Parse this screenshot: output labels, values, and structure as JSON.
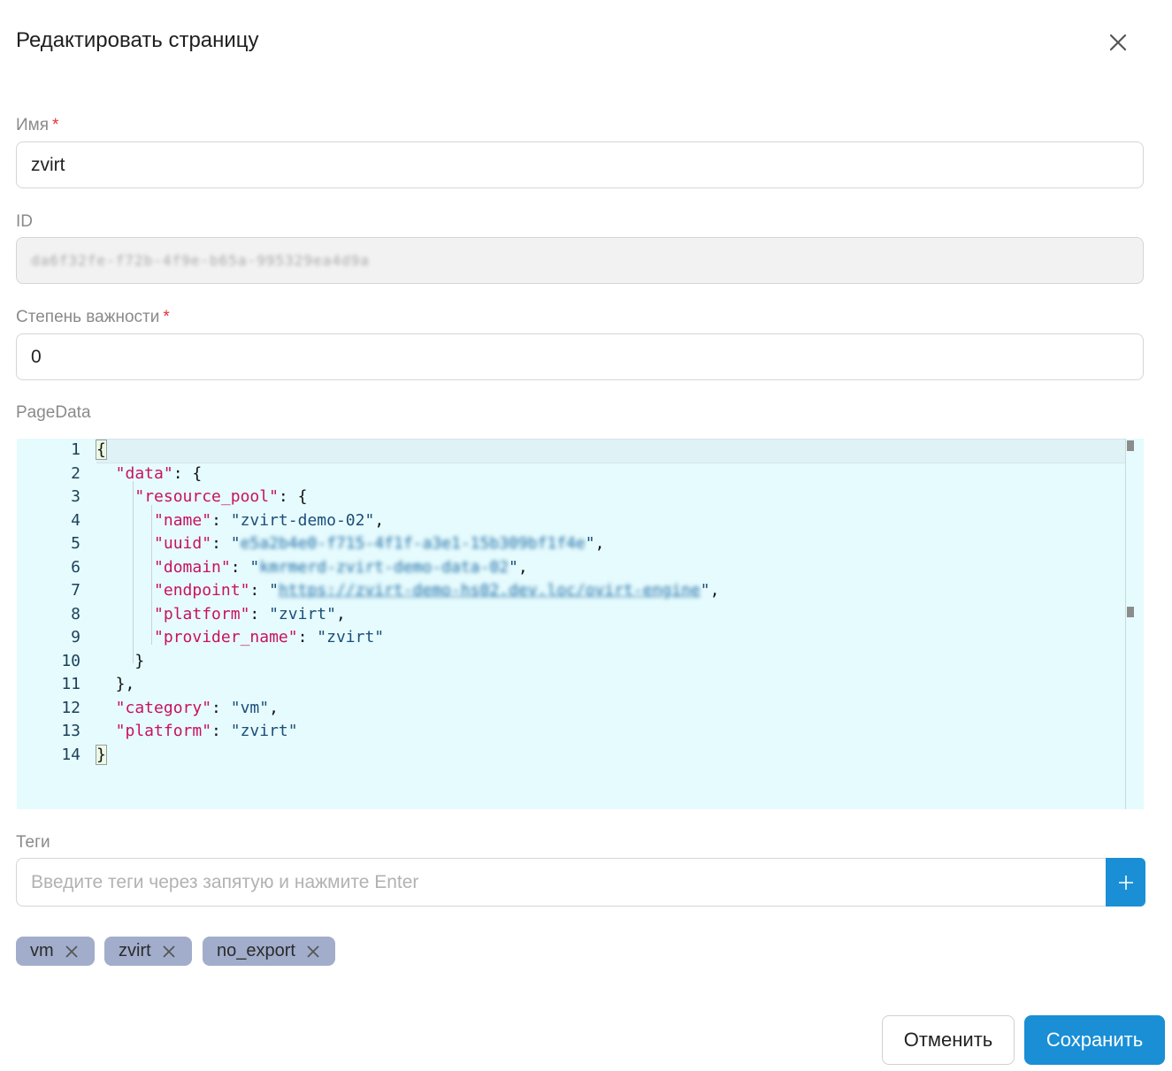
{
  "dialog": {
    "title": "Редактировать страницу",
    "close_icon": "close-icon"
  },
  "form": {
    "name": {
      "label": "Имя",
      "required_mark": "*",
      "value": "zvirt"
    },
    "id": {
      "label": "ID",
      "value": "da6f32fe-f72b-4f9e-b65a-995329ea4d9a"
    },
    "severity": {
      "label": "Степень важности",
      "required_mark": "*",
      "value": "0"
    },
    "page_data": {
      "label": "PageData",
      "lines": [
        {
          "n": "1"
        },
        {
          "n": "2",
          "key": "\"data\"",
          "after": ": {"
        },
        {
          "n": "3",
          "key": "\"resource_pool\"",
          "after": ": {"
        },
        {
          "n": "4",
          "key": "\"name\"",
          "colon": ": ",
          "val": "\"zvirt-demo-02\"",
          "tail": ","
        },
        {
          "n": "5",
          "key": "\"uuid\"",
          "colon": ": ",
          "val_open": "\"",
          "val_blur": "e5a2b4e0-f715-4f1f-a3e1-15b309bf1f4e",
          "val_close": "\"",
          "tail": ","
        },
        {
          "n": "6",
          "key": "\"domain\"",
          "colon": ": ",
          "val_open": "\"",
          "val_blur": "kmrmerd-zvirt-demo-data-02",
          "val_close": "\"",
          "tail": ","
        },
        {
          "n": "7",
          "key": "\"endpoint\"",
          "colon": ": ",
          "val_open": "\"",
          "val_blur": "https://zvirt-demo-hs02.dev.loc/ovirt-engine",
          "val_close": "\"",
          "tail": ","
        },
        {
          "n": "8",
          "key": "\"platform\"",
          "colon": ": ",
          "val": "\"zvirt\"",
          "tail": ","
        },
        {
          "n": "9",
          "key": "\"provider_name\"",
          "colon": ": ",
          "val": "\"zvirt\"",
          "tail": ""
        },
        {
          "n": "10",
          "after": "}"
        },
        {
          "n": "11",
          "after": "},"
        },
        {
          "n": "12",
          "key": "\"category\"",
          "colon": ": ",
          "val": "\"vm\"",
          "tail": ","
        },
        {
          "n": "13",
          "key": "\"platform\"",
          "colon": ": ",
          "val": "\"zvirt\"",
          "tail": ""
        },
        {
          "n": "14"
        }
      ],
      "brace_open": "{",
      "brace_close": "}"
    },
    "tags": {
      "label": "Теги",
      "placeholder": "Введите теги через запятую и нажмите Enter",
      "add_icon": "plus-icon",
      "items": [
        "vm",
        "zvirt",
        "no_export"
      ]
    }
  },
  "actions": {
    "cancel_label": "Отменить",
    "save_label": "Сохранить"
  },
  "colors": {
    "accent": "#1a8fd6",
    "chip": "#a1adcb",
    "editor_bg": "#e6fbfd",
    "json_key": "#c8125f",
    "json_string": "#1b4f7a",
    "required": "#e0343f"
  }
}
